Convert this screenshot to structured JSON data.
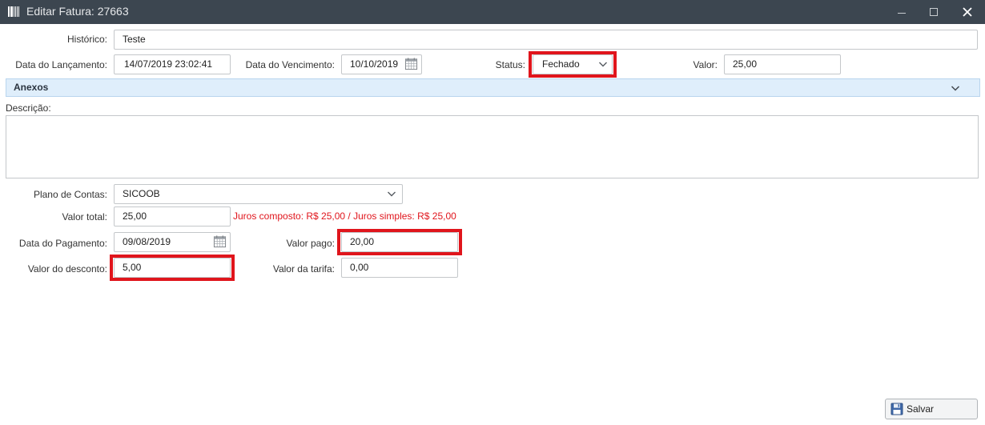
{
  "window": {
    "title": "Editar Fatura: 27663",
    "minimize_label": "Minimize",
    "maximize_label": "Maximize",
    "close_label": "Close"
  },
  "form": {
    "historico": {
      "label": "Histórico:",
      "value": "Teste"
    },
    "data_lancamento": {
      "label": "Data do Lançamento:",
      "value": "14/07/2019  23:02:41"
    },
    "data_vencimento": {
      "label": "Data do Vencimento:",
      "value": "10/10/2019"
    },
    "status": {
      "label": "Status:",
      "value": "Fechado"
    },
    "valor": {
      "label": "Valor:",
      "value": "25,00"
    },
    "anexos": {
      "title": "Anexos"
    },
    "descricao": {
      "label": "Descrição:",
      "value": ""
    },
    "plano_contas": {
      "label": "Plano de Contas:",
      "value": "SICOOB"
    },
    "valor_total": {
      "label": "Valor total:",
      "value": "25,00"
    },
    "juros_info": "Juros composto: R$ 25,00 / Juros simples: R$ 25,00",
    "data_pagamento": {
      "label": "Data do Pagamento:",
      "value": "09/08/2019"
    },
    "valor_pago": {
      "label": "Valor pago:",
      "value": "20,00"
    },
    "valor_desconto": {
      "label": "Valor do desconto:",
      "value": "5,00"
    },
    "valor_tarifa": {
      "label": "Valor da tarifa:",
      "value": "0,00"
    }
  },
  "footer": {
    "save_label": "Salvar"
  },
  "colors": {
    "titlebar": "#3c4650",
    "highlight": "#e0151c",
    "section_header": "#dfeefb",
    "info_text": "#e0151c"
  },
  "icons": {
    "app": "barcode-icon",
    "calendar": "calendar-icon",
    "dropdown": "chevron-down-icon",
    "save": "floppy-disk-icon"
  }
}
